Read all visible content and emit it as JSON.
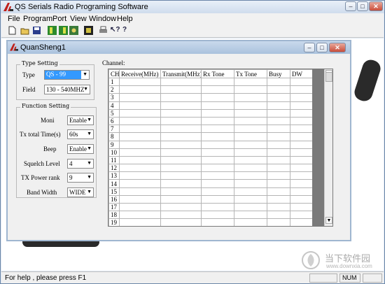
{
  "app": {
    "title": "QS Serials Radio Programing Software",
    "caption_buttons": [
      "–",
      "□",
      "✕"
    ]
  },
  "menu": [
    "File",
    "Program",
    "Port",
    "View",
    "Window",
    "Help"
  ],
  "toolbar_icons": [
    "new-icon",
    "open-icon",
    "save-icon",
    "read-radio-icon",
    "write-radio-icon",
    "program-icon",
    "port-icon",
    "print-icon",
    "context-help-icon",
    "about-icon"
  ],
  "child": {
    "title": "QuanSheng1",
    "caption_buttons": [
      "–",
      "□",
      "✕"
    ]
  },
  "type_setting": {
    "title": "Type Setting",
    "type_label": "Type",
    "type_value": "QS - 99",
    "field_label": "Field",
    "field_value": "130 - 540MHZ"
  },
  "function_setting": {
    "title": "Function Setting",
    "moni_label": "Moni",
    "moni_value": "Enable",
    "tx_total_label": "Tx total Time(s)",
    "tx_total_value": "60s",
    "beep_label": "Beep",
    "beep_value": "Enable",
    "squelch_label": "Squelch Level",
    "squelch_value": "4",
    "tx_power_label": "TX Power rank",
    "tx_power_value": "9",
    "band_width_label": "Band  Width",
    "band_width_value": "WIDE"
  },
  "channel": {
    "label": "Channel:",
    "columns": [
      "CH",
      "Receive(MHz)",
      "Transmit(MHz)",
      "Rx Tone",
      "Tx Tone",
      "Busy",
      "DW"
    ],
    "rows": [
      "1",
      "2",
      "3",
      "4",
      "5",
      "6",
      "7",
      "8",
      "9",
      "10",
      "11",
      "12",
      "13",
      "14",
      "15",
      "16",
      "17",
      "18",
      "19"
    ]
  },
  "status": {
    "help_text": "For help , please press F1",
    "num": "NUM"
  },
  "watermark": {
    "text": "当下软件园",
    "url": "www.downxia.com"
  }
}
